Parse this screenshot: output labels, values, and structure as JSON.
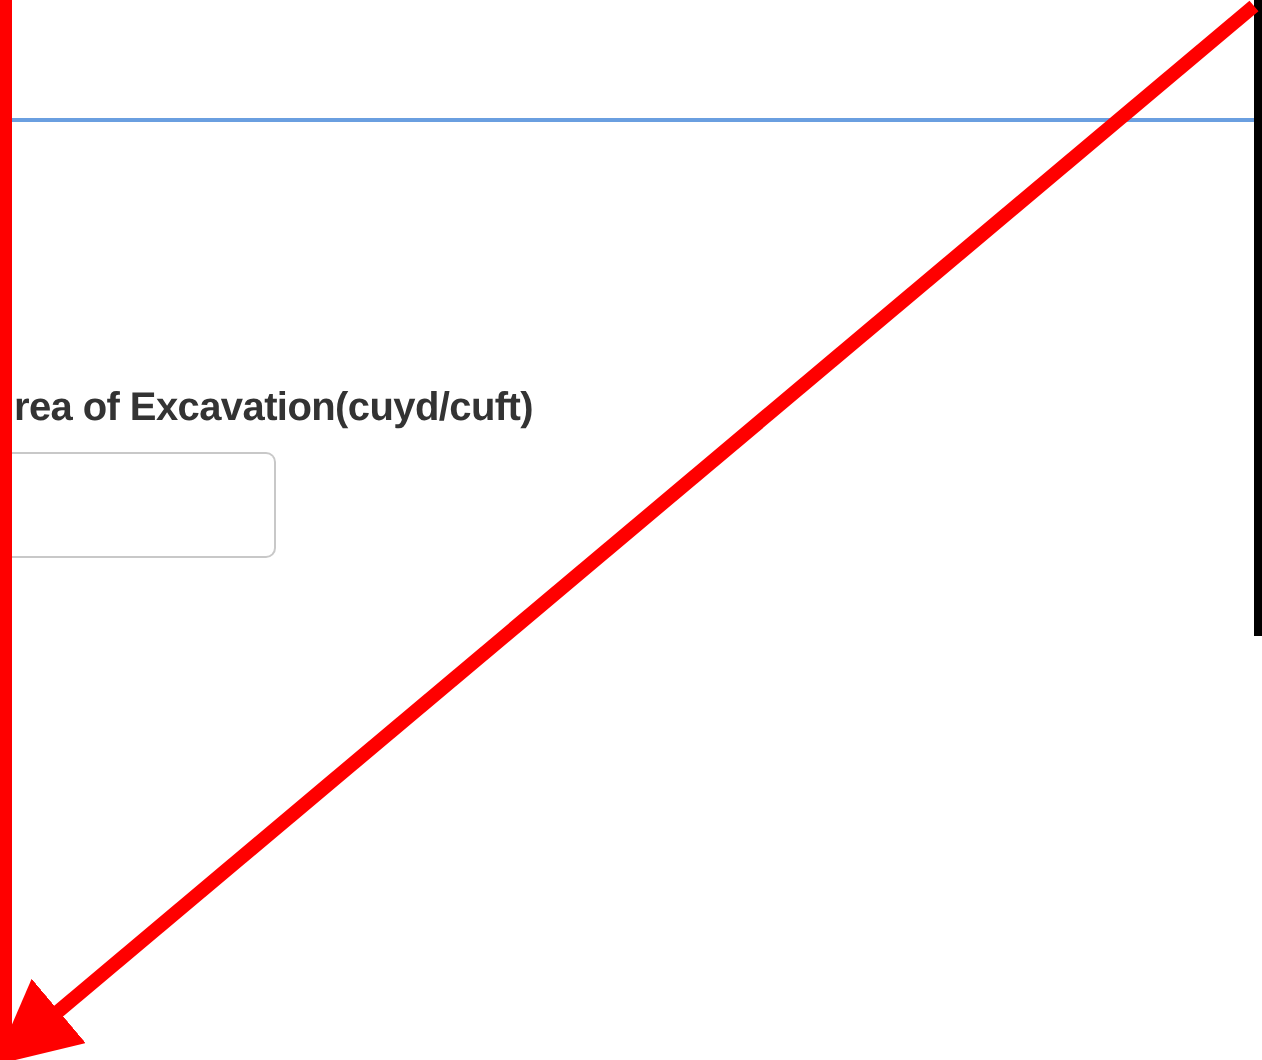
{
  "field": {
    "label": "rea of Excavation(cuyd/cuft)"
  }
}
